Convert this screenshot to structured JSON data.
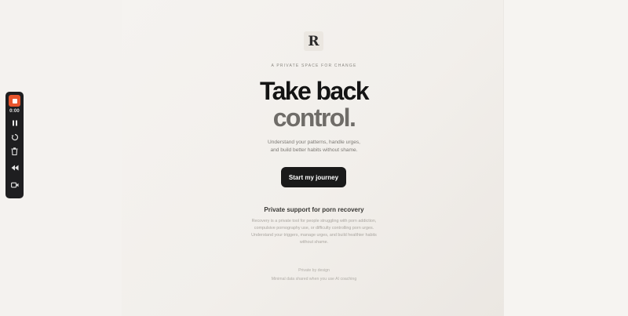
{
  "recorder": {
    "timer": "0:00",
    "buttons": [
      "stop",
      "pause",
      "restart",
      "delete",
      "rewind",
      "camera"
    ],
    "stop_color": "#e8552d"
  },
  "brand": {
    "logo_letter": "R"
  },
  "hero": {
    "eyebrow": "A PRIVATE SPACE FOR CHANGE",
    "title_line1": "Take back",
    "title_line2": "control.",
    "subtitle_line1": "Understand your patterns, handle urges,",
    "subtitle_line2": "and build better habits without shame.",
    "cta_label": "Start my journey"
  },
  "support": {
    "title": "Private support for porn recovery",
    "body_lines": [
      "Recovery is a private tool for people struggling with porn addiction,",
      "compulsive pornography use, or difficulty controlling porn urges.",
      "Understand your triggers, manage urges, and build healthier habits",
      "without shame."
    ]
  },
  "footer": {
    "line1": "Private by design",
    "line2": "Minimal data shared when you use AI coaching"
  }
}
